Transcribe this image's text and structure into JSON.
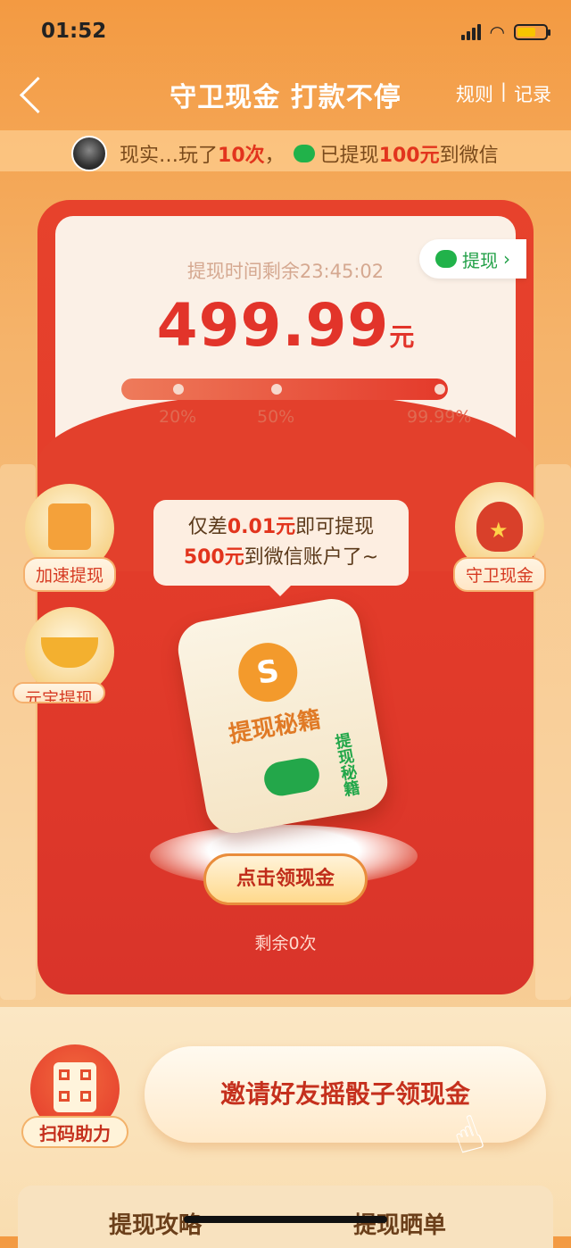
{
  "status_bar": {
    "time": "01:52"
  },
  "nav": {
    "title": "守卫现金 打款不停",
    "rules": "规则",
    "separator": "|",
    "records": "记录"
  },
  "ticker": {
    "name": "现实…",
    "played_prefix": " 玩了",
    "played_count": "10次",
    "comma": "，",
    "withdrawn_prefix": "已提现",
    "withdrawn_amount": "100元",
    "withdrawn_suffix": "到微信"
  },
  "card": {
    "countdown_label": "提现时间剩余",
    "countdown_value": "23:45:02",
    "amount": "499.99",
    "unit": "元",
    "withdraw_button": "提现",
    "progress_fraction": 0.9999,
    "progress_labels": [
      "20%",
      "50%",
      "99.99%"
    ]
  },
  "side": {
    "left_top": "加速提现",
    "left_bottom": "元宝提现",
    "right_top": "守卫现金"
  },
  "tooltip": {
    "line1_prefix": "仅差",
    "line1_amount": "0.01元",
    "line1_suffix": "即可提现",
    "line2_amount": "500元",
    "line2_suffix": "到微信账户了~"
  },
  "dice": {
    "coin_symbol": "S",
    "face_text": "提现秘籍",
    "side_text": "提现秘籍"
  },
  "claim_button": "点击领现金",
  "remaining": "剩余0次",
  "bottom": {
    "scan_label": "扫码助力",
    "invite_button": "邀请好友摇骰子领现金",
    "tabs": [
      "提现攻略",
      "提现晒单"
    ]
  },
  "colors": {
    "accent_red": "#e2341d",
    "wechat_green": "#21b24a",
    "gold": "#f39a2c"
  }
}
